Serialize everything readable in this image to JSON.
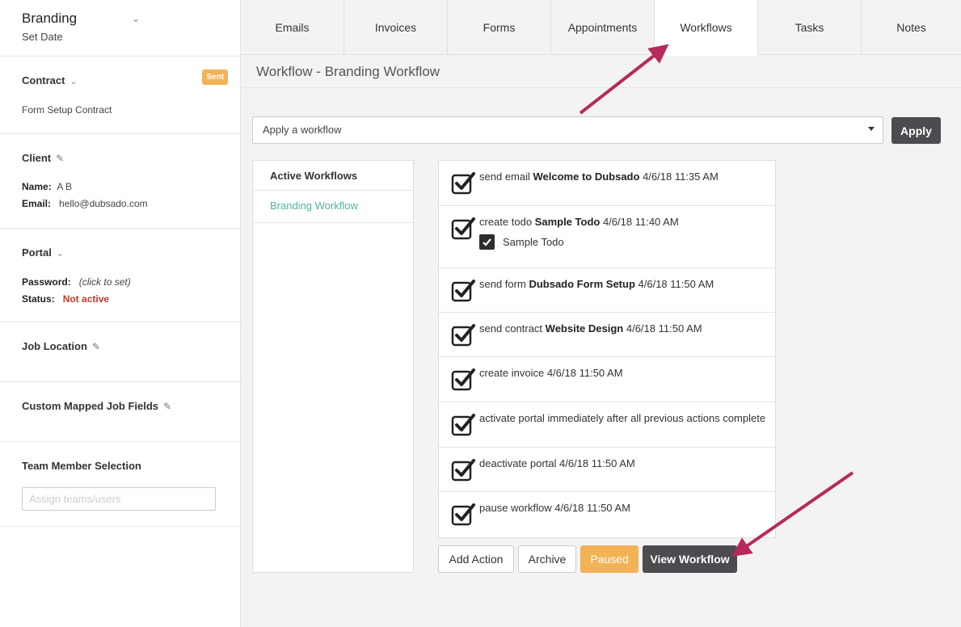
{
  "sidebar": {
    "header": {
      "title": "Branding",
      "subtitle": "Set Date"
    },
    "contract": {
      "title": "Contract",
      "badge": "Sent",
      "value": "Form Setup Contract"
    },
    "client": {
      "title": "Client",
      "name_label": "Name:",
      "name_value": "A B",
      "email_label": "Email:",
      "email_value": "hello@dubsado.com"
    },
    "portal": {
      "title": "Portal",
      "password_label": "Password:",
      "password_value": "(click to set)",
      "status_label": "Status:",
      "status_value": "Not active"
    },
    "job_location": {
      "title": "Job Location"
    },
    "custom_fields": {
      "title": "Custom Mapped Job Fields"
    },
    "team": {
      "title": "Team Member Selection",
      "placeholder": "Assign teams/users"
    }
  },
  "tabs": [
    {
      "label": "Emails"
    },
    {
      "label": "Invoices"
    },
    {
      "label": "Forms"
    },
    {
      "label": "Appointments"
    },
    {
      "label": "Workflows",
      "active": true
    },
    {
      "label": "Tasks"
    },
    {
      "label": "Notes"
    }
  ],
  "main": {
    "title": "Workflow - Branding Workflow",
    "select_value": "Apply a workflow",
    "apply_label": "Apply",
    "workflows_header": "Active Workflows",
    "workflows": [
      {
        "label": "Branding Workflow"
      }
    ],
    "actions": [
      {
        "pre": "send email",
        "bold": "Welcome to Dubsado",
        "post": "4/6/18 11:35 AM"
      },
      {
        "pre": "create todo",
        "bold": "Sample Todo",
        "post": "4/6/18 11:40 AM",
        "sub": "Sample Todo"
      },
      {
        "pre": "send form",
        "bold": "Dubsado Form Setup",
        "post": "4/6/18 11:50 AM"
      },
      {
        "pre": "send contract",
        "bold": "Website Design",
        "post": "4/6/18 11:50 AM"
      },
      {
        "pre": "create invoice 4/6/18 11:50 AM",
        "bold": "",
        "post": ""
      },
      {
        "pre": "activate portal immediately after all previous actions complete",
        "bold": "",
        "post": ""
      },
      {
        "pre": "deactivate portal 4/6/18 11:50 AM",
        "bold": "",
        "post": ""
      },
      {
        "pre": "pause workflow 4/6/18 11:50 AM",
        "bold": "",
        "post": ""
      }
    ],
    "buttons": {
      "add_action": "Add Action",
      "archive": "Archive",
      "paused": "Paused",
      "view_workflow": "View Workflow"
    }
  },
  "colors": {
    "accent_orange": "#f3b256",
    "dark_button": "#4b4b50",
    "link_teal": "#4fb3a0",
    "status_red": "#c0392b",
    "arrow": "#b8285c"
  }
}
